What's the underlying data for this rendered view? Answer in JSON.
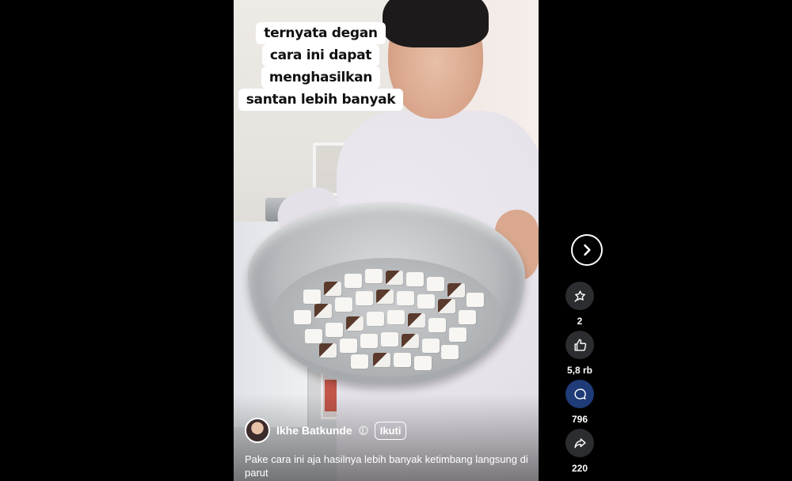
{
  "video": {
    "caption_lines": [
      "ternyata degan",
      "cara ini dapat",
      "menghasilkan",
      "santan lebih banyak"
    ],
    "author": {
      "name": "Ikhe Batkunde",
      "follow_label": "Ikuti"
    },
    "description": "Pake cara ini aja hasilnya lebih banyak ketimbang langsung di parut"
  },
  "actions": {
    "next_icon": "chevron-right-icon",
    "items": [
      {
        "icon": "star-sparkle-icon",
        "count": "2"
      },
      {
        "icon": "thumbs-up-icon",
        "count": "5,8 rb"
      },
      {
        "icon": "comment-icon",
        "count": "796"
      },
      {
        "icon": "share-icon",
        "count": "220"
      }
    ]
  },
  "colors": {
    "background": "#000000",
    "comment_active": "#1f3b78",
    "action_bg": "#2c2d30"
  }
}
